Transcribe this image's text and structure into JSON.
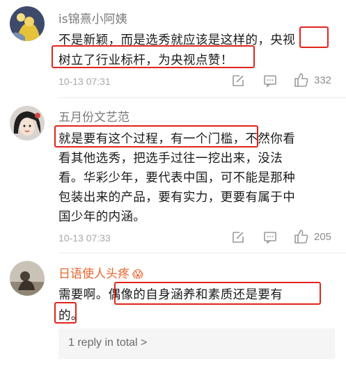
{
  "comments": [
    {
      "username": "is锦熹小阿姨",
      "lines": [
        "不是新颖，而是选秀就应该是这样的，央视",
        "树立了行业标杆，为央视点赞！"
      ],
      "time": "10-13 07:31",
      "likes": "332"
    },
    {
      "username": "五月份文艺范",
      "lines": [
        "就是要有这个过程，有一个门槛，不然你看",
        "看其他选秀，把选手过往一挖出来，没法",
        "看。华彩少年，要代表中国，可不能是那种",
        "包装出来的产品，要有实力，更要有属于中",
        "国少年的内涵。"
      ],
      "time": "10-13 07:33",
      "likes": "205"
    },
    {
      "username": "日语使人头疼",
      "emoji": "😱",
      "lines": [
        "需要啊。偶像的自身涵养和素质还是要有",
        "的。"
      ]
    }
  ],
  "replies_link": "1 reply in total >",
  "colors": {
    "highlight": "#e0241b",
    "username_orange": "#e8652b"
  },
  "icons": [
    "edit-icon",
    "message-icon",
    "thumbs-up-icon"
  ]
}
